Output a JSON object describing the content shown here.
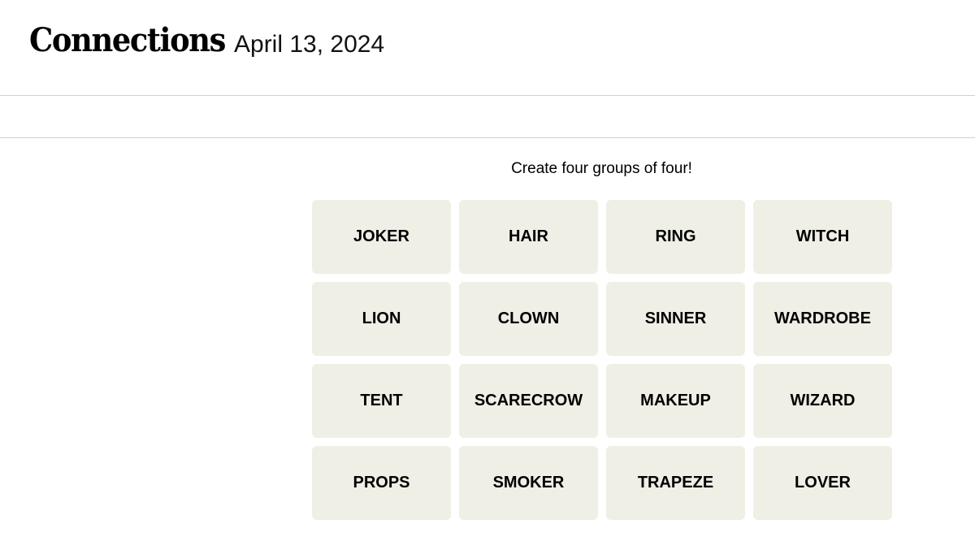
{
  "header": {
    "title": "Connections",
    "date": "April 13, 2024"
  },
  "game": {
    "prompt": "Create four groups of four!",
    "tile_color": "#efefe6",
    "tiles": [
      "JOKER",
      "HAIR",
      "RING",
      "WITCH",
      "LION",
      "CLOWN",
      "SINNER",
      "WARDROBE",
      "TENT",
      "SCARECROW",
      "MAKEUP",
      "WIZARD",
      "PROPS",
      "SMOKER",
      "TRAPEZE",
      "LOVER"
    ]
  }
}
